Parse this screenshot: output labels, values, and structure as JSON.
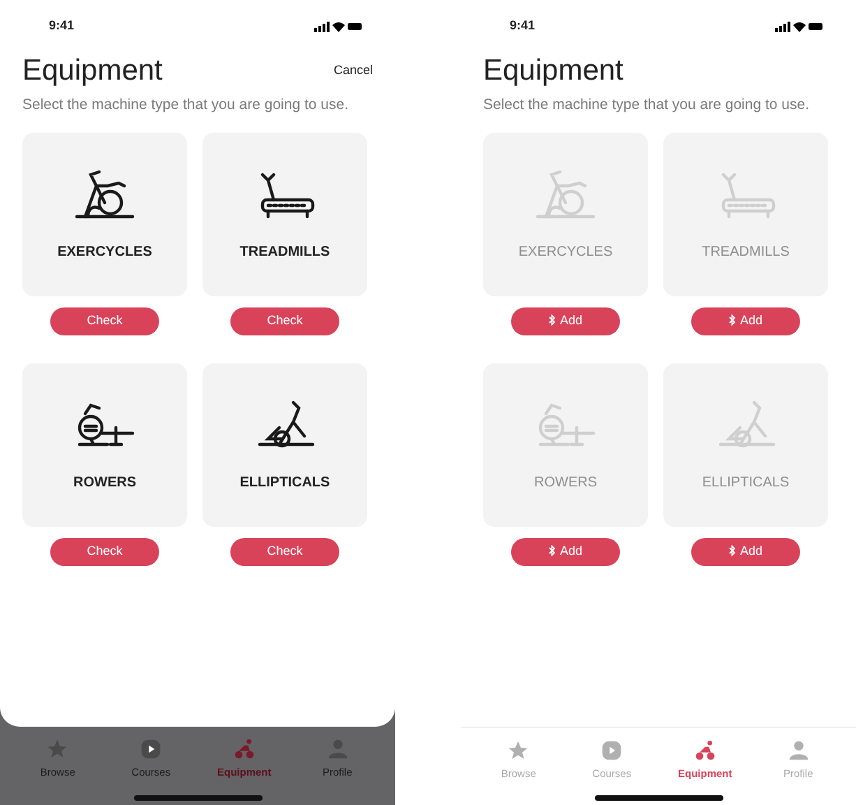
{
  "screens": [
    {
      "dimmed": true,
      "status_time": "9:41",
      "title": "Equipment",
      "cancel": "Cancel",
      "subtitle": "Select the machine type that you are going to use.",
      "machines": [
        {
          "kind": "exercycle",
          "name": "EXERCYCLES",
          "disabled": false,
          "button": {
            "label": "Check",
            "bluetooth": false
          }
        },
        {
          "kind": "treadmill",
          "name": "TREADMILLS",
          "disabled": false,
          "button": {
            "label": "Check",
            "bluetooth": false
          }
        },
        {
          "kind": "rower",
          "name": "ROWERS",
          "disabled": false,
          "button": {
            "label": "Check",
            "bluetooth": false
          }
        },
        {
          "kind": "elliptical",
          "name": "ELLIPTICALS",
          "disabled": false,
          "button": {
            "label": "Check",
            "bluetooth": false
          }
        }
      ],
      "tabs": [
        {
          "kind": "star",
          "label": "Browse",
          "selected": false
        },
        {
          "kind": "play",
          "label": "Courses",
          "selected": false
        },
        {
          "kind": "bike",
          "label": "Equipment",
          "selected": true
        },
        {
          "kind": "person",
          "label": "Profile",
          "selected": false
        }
      ]
    },
    {
      "dimmed": false,
      "status_time": "9:41",
      "title": "Equipment",
      "subtitle": "Select the machine type that you are going to use.",
      "machines": [
        {
          "kind": "exercycle",
          "name": "EXERCYCLES",
          "disabled": true,
          "button": {
            "label": "Add",
            "bluetooth": true
          }
        },
        {
          "kind": "treadmill",
          "name": "TREADMILLS",
          "disabled": true,
          "button": {
            "label": "Add",
            "bluetooth": true
          }
        },
        {
          "kind": "rower",
          "name": "ROWERS",
          "disabled": true,
          "button": {
            "label": "Add",
            "bluetooth": true
          }
        },
        {
          "kind": "elliptical",
          "name": "ELLIPTICALS",
          "disabled": true,
          "button": {
            "label": "Add",
            "bluetooth": true
          }
        }
      ],
      "tabs": [
        {
          "kind": "star",
          "label": "Browse",
          "selected": false
        },
        {
          "kind": "play",
          "label": "Courses",
          "selected": false
        },
        {
          "kind": "bike",
          "label": "Equipment",
          "selected": true
        },
        {
          "kind": "person",
          "label": "Profile",
          "selected": false
        }
      ]
    }
  ]
}
